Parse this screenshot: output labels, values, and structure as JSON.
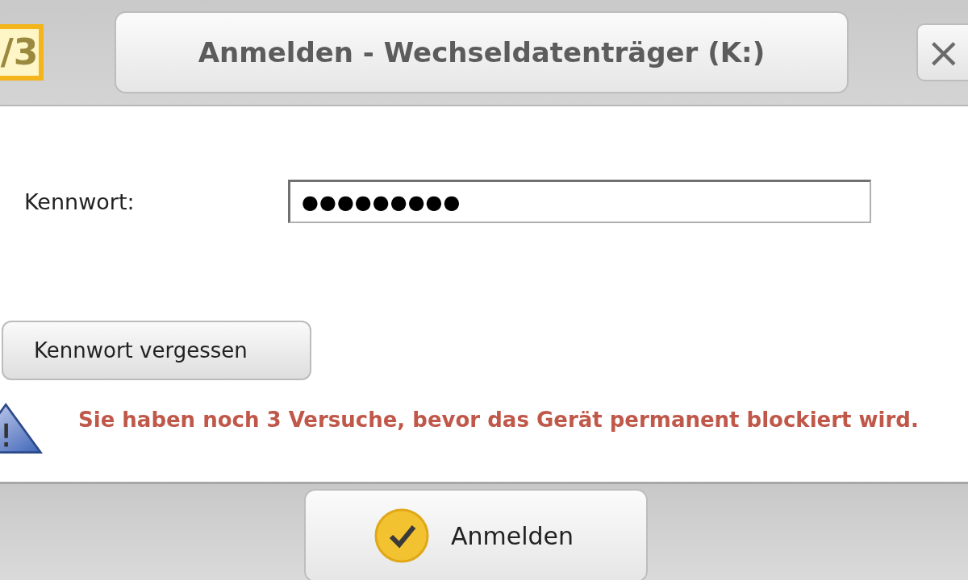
{
  "window": {
    "logo": "/3",
    "title": "Anmelden - Wechseldatenträger (K:)",
    "close": "×"
  },
  "form": {
    "label": "Kennwort:",
    "value": "●●●●●●●●●"
  },
  "forgot_button": "Kennwort vergessen",
  "warning": "Sie haben noch 3 Versuche, bevor das Gerät permanent blockiert wird.",
  "login_button": "Anmelden"
}
